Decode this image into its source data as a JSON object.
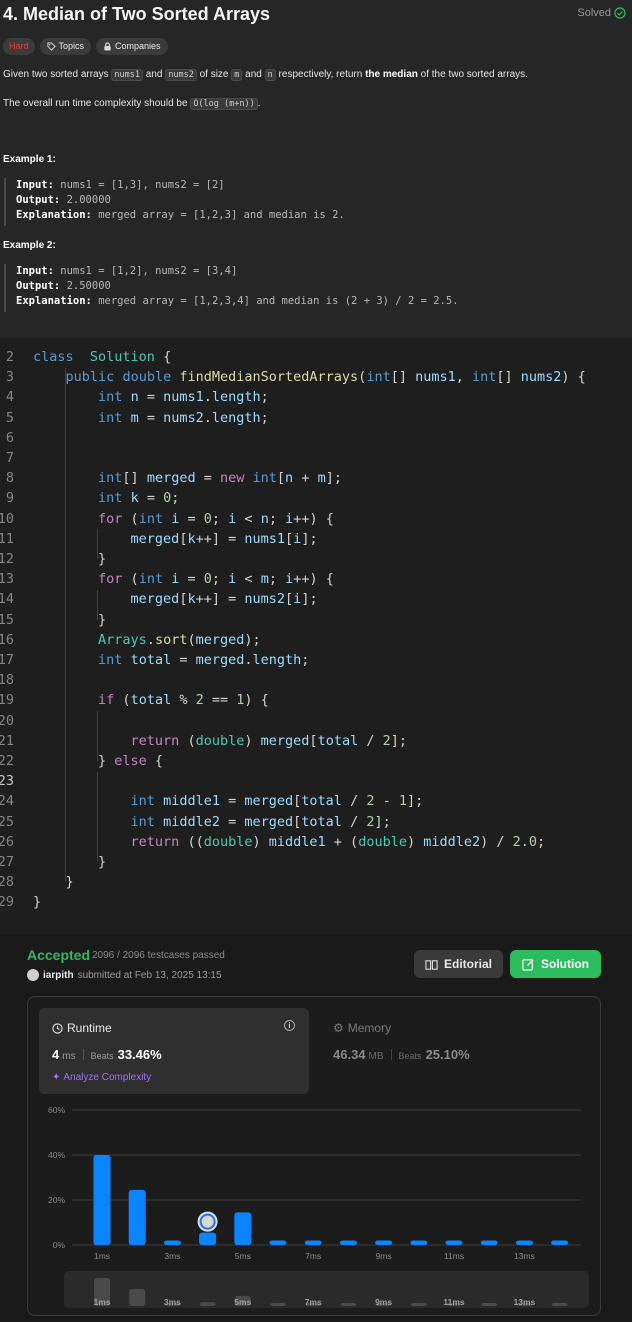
{
  "problem": {
    "title": "4. Median of Two Sorted Arrays",
    "status": "Solved",
    "difficulty": "Hard",
    "topics_label": "Topics",
    "companies_label": "Companies",
    "desc_p1": [
      "Given two sorted arrays ",
      "nums1",
      " and ",
      "nums2",
      " of size ",
      "m",
      " and ",
      "n",
      " respectively, return ",
      "the median",
      " of the two sorted arrays."
    ],
    "desc_p2": [
      "The overall run time complexity should be ",
      "O(log (m+n))",
      "."
    ],
    "examples": [
      {
        "heading": "Example 1:",
        "input_label": "Input:",
        "input": "nums1 = [1,3], nums2 = [2]",
        "output_label": "Output:",
        "output": "2.00000",
        "explanation_label": "Explanation:",
        "explanation": "merged array = [1,2,3] and median is 2."
      },
      {
        "heading": "Example 2:",
        "input_label": "Input:",
        "input": "nums1 = [1,2], nums2 = [3,4]",
        "output_label": "Output:",
        "output": "2.50000",
        "explanation_label": "Explanation:",
        "explanation": "merged array = [1,2,3,4] and median is (2 + 3) / 2 = 2.5."
      }
    ]
  },
  "editor": {
    "current_line": 23,
    "lines": [
      {
        "n": "2",
        "t": [
          [
            "kw",
            "class"
          ],
          [
            "",
            "  "
          ],
          [
            "ty",
            "Solution"
          ],
          [
            "",
            " {"
          ]
        ]
      },
      {
        "n": "3",
        "t": [
          [
            "",
            "    "
          ],
          [
            "kw",
            "public"
          ],
          [
            "",
            " "
          ],
          [
            "kw",
            "double"
          ],
          [
            "",
            " "
          ],
          [
            "fn",
            "findMedianSortedArrays"
          ],
          [
            "",
            "("
          ],
          [
            "kw",
            "int"
          ],
          [
            "",
            "[] "
          ],
          [
            "vr",
            "nums1"
          ],
          [
            "",
            ", "
          ],
          [
            "kw",
            "int"
          ],
          [
            "",
            "[] "
          ],
          [
            "vr",
            "nums2"
          ],
          [
            "",
            ") {"
          ]
        ]
      },
      {
        "n": "4",
        "t": [
          [
            "",
            "        "
          ],
          [
            "kw",
            "int"
          ],
          [
            "",
            " "
          ],
          [
            "vr",
            "n"
          ],
          [
            "",
            " = "
          ],
          [
            "vr",
            "nums1"
          ],
          [
            "",
            "."
          ],
          [
            "vr",
            "length"
          ],
          [
            "",
            ";"
          ]
        ]
      },
      {
        "n": "5",
        "t": [
          [
            "",
            "        "
          ],
          [
            "kw",
            "int"
          ],
          [
            "",
            " "
          ],
          [
            "vr",
            "m"
          ],
          [
            "",
            " = "
          ],
          [
            "vr",
            "nums2"
          ],
          [
            "",
            "."
          ],
          [
            "vr",
            "length"
          ],
          [
            "",
            ";"
          ]
        ]
      },
      {
        "n": "6",
        "t": []
      },
      {
        "n": "7",
        "t": []
      },
      {
        "n": "8",
        "t": [
          [
            "",
            "        "
          ],
          [
            "kw",
            "int"
          ],
          [
            "",
            "[] "
          ],
          [
            "vr",
            "merged"
          ],
          [
            "",
            " = "
          ],
          [
            "ct",
            "new"
          ],
          [
            "",
            " "
          ],
          [
            "kw",
            "int"
          ],
          [
            "",
            "["
          ],
          [
            "vr",
            "n"
          ],
          [
            "",
            " + "
          ],
          [
            "vr",
            "m"
          ],
          [
            "",
            "];"
          ]
        ]
      },
      {
        "n": "9",
        "t": [
          [
            "",
            "        "
          ],
          [
            "kw",
            "int"
          ],
          [
            "",
            " "
          ],
          [
            "vr",
            "k"
          ],
          [
            "",
            " = "
          ],
          [
            "nm",
            "0"
          ],
          [
            "",
            ";"
          ]
        ]
      },
      {
        "n": "10",
        "t": [
          [
            "",
            "        "
          ],
          [
            "ct",
            "for"
          ],
          [
            "",
            " ("
          ],
          [
            "kw",
            "int"
          ],
          [
            "",
            " "
          ],
          [
            "vr",
            "i"
          ],
          [
            "",
            " = "
          ],
          [
            "nm",
            "0"
          ],
          [
            "",
            "; "
          ],
          [
            "vr",
            "i"
          ],
          [
            "",
            " < "
          ],
          [
            "vr",
            "n"
          ],
          [
            "",
            "; "
          ],
          [
            "vr",
            "i"
          ],
          [
            "",
            "++) {"
          ]
        ]
      },
      {
        "n": "11",
        "t": [
          [
            "",
            "            "
          ],
          [
            "vr",
            "merged"
          ],
          [
            "",
            "["
          ],
          [
            "vr",
            "k"
          ],
          [
            "",
            "++] = "
          ],
          [
            "vr",
            "nums1"
          ],
          [
            "",
            "["
          ],
          [
            "vr",
            "i"
          ],
          [
            "",
            "];"
          ]
        ]
      },
      {
        "n": "12",
        "t": [
          [
            "",
            "        }"
          ]
        ]
      },
      {
        "n": "13",
        "t": [
          [
            "",
            "        "
          ],
          [
            "ct",
            "for"
          ],
          [
            "",
            " ("
          ],
          [
            "kw",
            "int"
          ],
          [
            "",
            " "
          ],
          [
            "vr",
            "i"
          ],
          [
            "",
            " = "
          ],
          [
            "nm",
            "0"
          ],
          [
            "",
            "; "
          ],
          [
            "vr",
            "i"
          ],
          [
            "",
            " < "
          ],
          [
            "vr",
            "m"
          ],
          [
            "",
            "; "
          ],
          [
            "vr",
            "i"
          ],
          [
            "",
            "++) {"
          ]
        ]
      },
      {
        "n": "14",
        "t": [
          [
            "",
            "            "
          ],
          [
            "vr",
            "merged"
          ],
          [
            "",
            "["
          ],
          [
            "vr",
            "k"
          ],
          [
            "",
            "++] = "
          ],
          [
            "vr",
            "nums2"
          ],
          [
            "",
            "["
          ],
          [
            "vr",
            "i"
          ],
          [
            "",
            "];"
          ]
        ]
      },
      {
        "n": "15",
        "t": [
          [
            "",
            "        }"
          ]
        ]
      },
      {
        "n": "16",
        "t": [
          [
            "",
            "        "
          ],
          [
            "ty",
            "Arrays"
          ],
          [
            "",
            "."
          ],
          [
            "fn",
            "sort"
          ],
          [
            "",
            "("
          ],
          [
            "vr",
            "merged"
          ],
          [
            "",
            ");"
          ]
        ]
      },
      {
        "n": "17",
        "t": [
          [
            "",
            "        "
          ],
          [
            "kw",
            "int"
          ],
          [
            "",
            " "
          ],
          [
            "vr",
            "total"
          ],
          [
            "",
            " = "
          ],
          [
            "vr",
            "merged"
          ],
          [
            "",
            "."
          ],
          [
            "vr",
            "length"
          ],
          [
            "",
            ";"
          ]
        ]
      },
      {
        "n": "18",
        "t": []
      },
      {
        "n": "19",
        "t": [
          [
            "",
            "        "
          ],
          [
            "ct",
            "if"
          ],
          [
            "",
            " ("
          ],
          [
            "vr",
            "total"
          ],
          [
            "",
            " % "
          ],
          [
            "nm",
            "2"
          ],
          [
            "",
            " == "
          ],
          [
            "nm",
            "1"
          ],
          [
            "",
            ") {"
          ]
        ]
      },
      {
        "n": "20",
        "t": []
      },
      {
        "n": "21",
        "t": [
          [
            "",
            "            "
          ],
          [
            "ct",
            "return"
          ],
          [
            "",
            " ("
          ],
          [
            "ty",
            "double"
          ],
          [
            "",
            ") "
          ],
          [
            "vr",
            "merged"
          ],
          [
            "",
            "["
          ],
          [
            "vr",
            "total"
          ],
          [
            "",
            " / "
          ],
          [
            "nm",
            "2"
          ],
          [
            "",
            "];"
          ]
        ]
      },
      {
        "n": "22",
        "t": [
          [
            "",
            "        } "
          ],
          [
            "ct",
            "else"
          ],
          [
            "",
            " {"
          ]
        ]
      },
      {
        "n": "23",
        "t": []
      },
      {
        "n": "24",
        "t": [
          [
            "",
            "            "
          ],
          [
            "kw",
            "int"
          ],
          [
            "",
            " "
          ],
          [
            "vr",
            "middle1"
          ],
          [
            "",
            " = "
          ],
          [
            "vr",
            "merged"
          ],
          [
            "",
            "["
          ],
          [
            "vr",
            "total"
          ],
          [
            "",
            " / "
          ],
          [
            "nm",
            "2"
          ],
          [
            "",
            " - "
          ],
          [
            "nm",
            "1"
          ],
          [
            "",
            "];"
          ]
        ]
      },
      {
        "n": "25",
        "t": [
          [
            "",
            "            "
          ],
          [
            "kw",
            "int"
          ],
          [
            "",
            " "
          ],
          [
            "vr",
            "middle2"
          ],
          [
            "",
            " = "
          ],
          [
            "vr",
            "merged"
          ],
          [
            "",
            "["
          ],
          [
            "vr",
            "total"
          ],
          [
            "",
            " / "
          ],
          [
            "nm",
            "2"
          ],
          [
            "",
            "];"
          ]
        ]
      },
      {
        "n": "26",
        "t": [
          [
            "",
            "            "
          ],
          [
            "ct",
            "return"
          ],
          [
            "",
            " (("
          ],
          [
            "ty",
            "double"
          ],
          [
            "",
            ") "
          ],
          [
            "vr",
            "middle1"
          ],
          [
            "",
            " + ("
          ],
          [
            "ty",
            "double"
          ],
          [
            "",
            ") "
          ],
          [
            "vr",
            "middle2"
          ],
          [
            "",
            ") / "
          ],
          [
            "nm",
            "2.0"
          ],
          [
            "",
            ";"
          ]
        ]
      },
      {
        "n": "27",
        "t": [
          [
            "",
            "        }"
          ]
        ]
      },
      {
        "n": "28",
        "t": [
          [
            "",
            "    }"
          ]
        ]
      },
      {
        "n": "29",
        "t": [
          [
            "",
            "}"
          ]
        ]
      }
    ]
  },
  "result": {
    "status": "Accepted",
    "testcases": "2096 / 2096 testcases passed",
    "user": "iarpith",
    "submitted_text": "submitted at Feb 13, 2025 13:15",
    "editorial_label": "Editorial",
    "solution_label": "Solution",
    "runtime": {
      "label": "Runtime",
      "value": "4",
      "unit": "ms",
      "beats_label": "Beats",
      "beats": "33.46%",
      "analyze_label": "Analyze Complexity"
    },
    "memory": {
      "label": "Memory",
      "value": "46.34",
      "unit": "MB",
      "beats_label": "Beats",
      "beats": "25.10%"
    },
    "accent_green": "#2cbb5d",
    "accent_blue": "#0a84ff"
  },
  "chart_data": {
    "type": "bar",
    "title": "",
    "xlabel": "",
    "ylabel": "",
    "ylim": [
      0,
      60
    ],
    "y_ticks": [
      "0%",
      "20%",
      "40%",
      "60%"
    ],
    "x_tick_labels": [
      "1ms",
      "3ms",
      "5ms",
      "7ms",
      "9ms",
      "11ms",
      "13ms"
    ],
    "categories": [
      "1ms",
      "2ms",
      "3ms",
      "4ms",
      "5ms",
      "6ms",
      "7ms",
      "8ms",
      "9ms",
      "10ms",
      "11ms",
      "12ms",
      "13ms",
      "14ms"
    ],
    "values": [
      40,
      24.5,
      2,
      5.5,
      14.5,
      2,
      2,
      2,
      2,
      2,
      2,
      2,
      2,
      2
    ],
    "highlight_index": 3,
    "minimap_values": [
      40,
      24.5,
      2,
      5.5,
      14.5,
      2,
      2,
      2,
      2,
      2,
      2,
      2,
      2,
      2
    ]
  }
}
